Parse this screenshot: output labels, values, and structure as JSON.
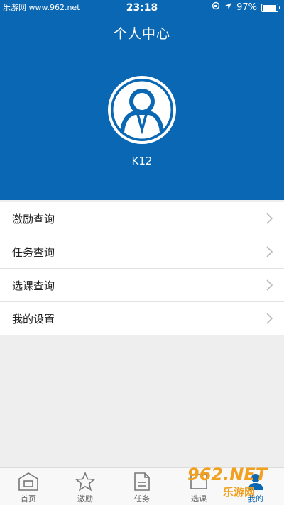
{
  "status_bar": {
    "watermark": "乐游网 www.962.net",
    "time": "23:18",
    "battery": "97%",
    "battery_level": 0.97
  },
  "header": {
    "title": "个人中心",
    "username": "K12"
  },
  "menu": {
    "items": [
      {
        "label": "激励查询"
      },
      {
        "label": "任务查询"
      },
      {
        "label": "选课查询"
      },
      {
        "label": "我的设置"
      }
    ]
  },
  "tabbar": {
    "tabs": [
      {
        "label": "首页"
      },
      {
        "label": "激励"
      },
      {
        "label": "任务"
      },
      {
        "label": "选课"
      },
      {
        "label": "我的"
      }
    ]
  },
  "watermark": {
    "brand": "962.NET",
    "sub": "乐游网"
  },
  "colors": {
    "primary": "#0a67b3",
    "background": "#eeeeee",
    "watermark": "#f1a11f"
  }
}
